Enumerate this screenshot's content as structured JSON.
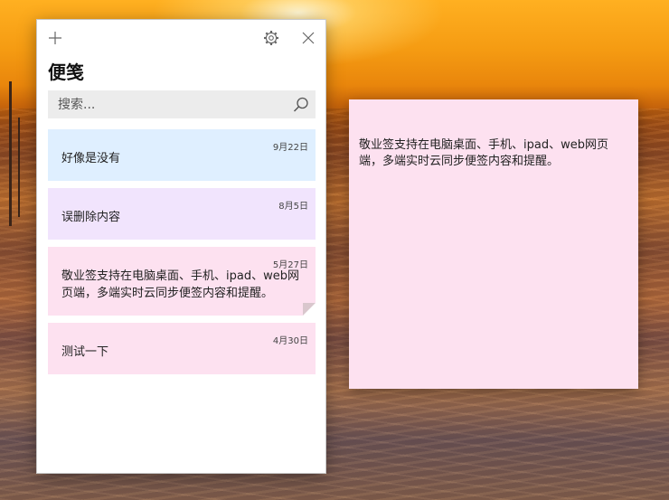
{
  "app": {
    "title": "便笺"
  },
  "toolbar": {
    "add_icon": "plus-icon",
    "settings_icon": "gear-icon",
    "close_icon": "close-icon"
  },
  "search": {
    "placeholder": "搜索...",
    "value": "",
    "icon": "search-icon"
  },
  "notes": [
    {
      "date": "9月22日",
      "text": "好像是没有",
      "color": "#dfefff"
    },
    {
      "date": "8月5日",
      "text": "误删除内容",
      "color": "#f1e4fd"
    },
    {
      "date": "5月27日",
      "text": "敬业签支持在电脑桌面、手机、ipad、web网页端，多端实时云同步便签内容和提醒。",
      "color": "#fde1f0"
    },
    {
      "date": "4月30日",
      "text": "测试一下",
      "color": "#fde1f0"
    }
  ],
  "open_note": {
    "text": "敬业签支持在电脑桌面、手机、ipad、web网页端，多端实时云同步便签内容和提醒。",
    "color": "#fde1f0"
  }
}
